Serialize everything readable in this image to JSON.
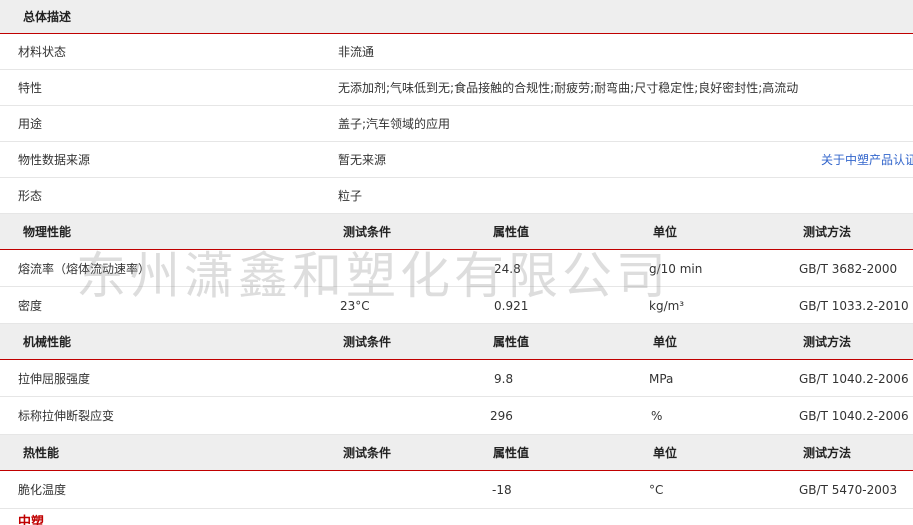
{
  "general": {
    "header": "总体描述",
    "rows": [
      {
        "label": "材料状态",
        "value": "非流通",
        "extra": ""
      },
      {
        "label": "特性",
        "value": "无添加剂;气味低到无;食品接触的合规性;耐疲劳;耐弯曲;尺寸稳定性;良好密封性;高流动",
        "extra": ""
      },
      {
        "label": "用途",
        "value": "盖子;汽车领域的应用",
        "extra": ""
      },
      {
        "label": "物性数据来源",
        "value": "暂无来源",
        "extra": "关于中塑产品认证"
      },
      {
        "label": "形态",
        "value": "粒子",
        "extra": ""
      }
    ]
  },
  "columns": {
    "condition": "测试条件",
    "value": "属性值",
    "unit": "单位",
    "method": "测试方法"
  },
  "physical": {
    "header": "物理性能",
    "rows": [
      {
        "name": "熔流率（熔体流动速率）",
        "condition": "",
        "value": "24.8",
        "unit": "g/10 min",
        "method": "GB/T 3682-2000"
      },
      {
        "name": "密度",
        "condition": "23°C",
        "value": "0.921",
        "unit": "kg/m³",
        "method": "GB/T 1033.2-2010"
      }
    ]
  },
  "mechanical": {
    "header": "机械性能",
    "rows": [
      {
        "name": "拉伸屈服强度",
        "condition": "",
        "value": "9.8",
        "unit": "MPa",
        "method": "GB/T 1040.2-2006"
      },
      {
        "name": "标称拉伸断裂应变",
        "condition": "",
        "value": "296",
        "unit": "%",
        "method": "GB/T 1040.2-2006"
      }
    ]
  },
  "thermal": {
    "header": "热性能",
    "rows": [
      {
        "name": "脆化温度",
        "condition": "",
        "value": "-18",
        "unit": "°C",
        "method": "GB/T 5470-2003"
      }
    ]
  },
  "watermark": "东州潇鑫和塑化有限公司",
  "footer": {
    "text": "中塑"
  }
}
